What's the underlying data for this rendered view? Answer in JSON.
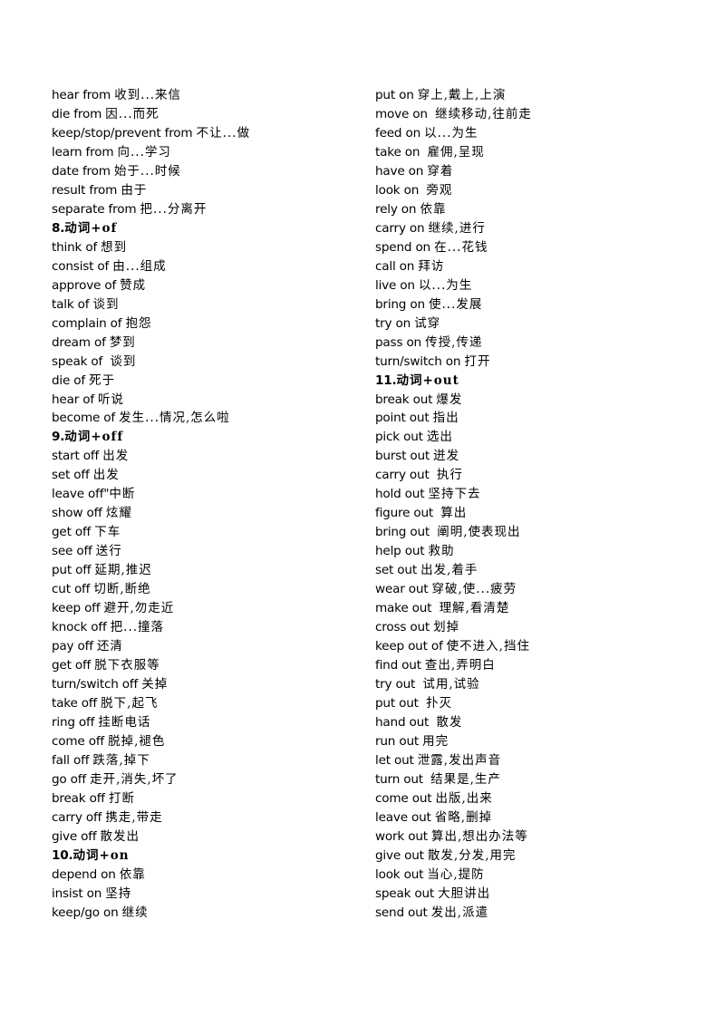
{
  "columns": [
    {
      "lines": [
        {
          "en": "hear from ",
          "zh": "收到...来信"
        },
        {
          "en": "die from ",
          "zh": "因...而死"
        },
        {
          "en": "keep/stop/prevent from ",
          "zh": "不让...做"
        },
        {
          "en": "learn from ",
          "zh": "向...学习"
        },
        {
          "en": "date from ",
          "zh": "始于...时候"
        },
        {
          "en": "result from ",
          "zh": "由于"
        },
        {
          "en": "separate from ",
          "zh": "把...分离开"
        },
        {
          "en": "8.",
          "zh": "动词+of",
          "header": true
        },
        {
          "en": "think of ",
          "zh": "想到"
        },
        {
          "en": "consist of ",
          "zh": "由...组成"
        },
        {
          "en": "approve of ",
          "zh": "赞成"
        },
        {
          "en": "talk of ",
          "zh": "谈到"
        },
        {
          "en": "complain of ",
          "zh": "抱怨"
        },
        {
          "en": "dream of ",
          "zh": "梦到"
        },
        {
          "en": "speak of  ",
          "zh": "谈到"
        },
        {
          "en": "die of ",
          "zh": "死于"
        },
        {
          "en": "hear of ",
          "zh": "听说"
        },
        {
          "en": "become of ",
          "zh": "发生...情况,怎么啦"
        },
        {
          "en": "9.",
          "zh": "动词+off",
          "header": true
        },
        {
          "en": "start off ",
          "zh": "出发"
        },
        {
          "en": "set off ",
          "zh": "出发"
        },
        {
          "en": "leave off\"",
          "zh": "中断"
        },
        {
          "en": "show off ",
          "zh": "炫耀"
        },
        {
          "en": "get off ",
          "zh": "下车"
        },
        {
          "en": "see off ",
          "zh": "送行"
        },
        {
          "en": "put off ",
          "zh": "延期,推迟"
        },
        {
          "en": "cut off ",
          "zh": "切断,断绝"
        },
        {
          "en": "keep off ",
          "zh": "避开,勿走近"
        },
        {
          "en": "knock off ",
          "zh": "把...撞落"
        },
        {
          "en": "pay off ",
          "zh": "还清"
        },
        {
          "en": "get off ",
          "zh": "脱下衣服等"
        },
        {
          "en": "turn/switch off ",
          "zh": "关掉"
        },
        {
          "en": "take off ",
          "zh": "脱下,起飞"
        },
        {
          "en": "ring off ",
          "zh": "挂断电话"
        },
        {
          "en": "come off ",
          "zh": "脱掉,褪色"
        },
        {
          "en": "fall off ",
          "zh": "跌落,掉下"
        },
        {
          "en": "go off ",
          "zh": "走开,消失,坏了"
        },
        {
          "en": "break off ",
          "zh": "打断"
        },
        {
          "en": "carry off ",
          "zh": "携走,带走"
        },
        {
          "en": "give off ",
          "zh": "散发出"
        },
        {
          "en": "10.",
          "zh": "动词+on",
          "header": true
        },
        {
          "en": "depend on ",
          "zh": "依靠"
        },
        {
          "en": "insist on ",
          "zh": "坚持"
        },
        {
          "en": "keep/go on ",
          "zh": "继续"
        }
      ]
    },
    {
      "lines": [
        {
          "en": "put on ",
          "zh": "穿上,戴上,上演"
        },
        {
          "en": "move on  ",
          "zh": "继续移动,往前走"
        },
        {
          "en": "feed on ",
          "zh": "以...为生"
        },
        {
          "en": "take on  ",
          "zh": "雇佣,呈现"
        },
        {
          "en": "have on ",
          "zh": "穿着"
        },
        {
          "en": "look on  ",
          "zh": "旁观"
        },
        {
          "en": "rely on ",
          "zh": "依靠"
        },
        {
          "en": "carry on ",
          "zh": "继续,进行"
        },
        {
          "en": "spend on ",
          "zh": "在...花钱"
        },
        {
          "en": "call on ",
          "zh": "拜访"
        },
        {
          "en": "live on ",
          "zh": "以...为生"
        },
        {
          "en": "bring on ",
          "zh": "使...发展"
        },
        {
          "en": "try on ",
          "zh": "试穿"
        },
        {
          "en": "pass on ",
          "zh": "传授,传递"
        },
        {
          "en": "turn/switch on ",
          "zh": "打开"
        },
        {
          "en": "11.",
          "zh": "动词+out",
          "header": true
        },
        {
          "en": "break out ",
          "zh": "爆发"
        },
        {
          "en": "point out ",
          "zh": "指出"
        },
        {
          "en": "pick out ",
          "zh": "选出"
        },
        {
          "en": "burst out ",
          "zh": "迸发"
        },
        {
          "en": "carry out  ",
          "zh": "执行"
        },
        {
          "en": "hold out ",
          "zh": "坚持下去"
        },
        {
          "en": "figure out  ",
          "zh": "算出"
        },
        {
          "en": "bring out  ",
          "zh": "阐明,使表现出"
        },
        {
          "en": "help out ",
          "zh": "救助"
        },
        {
          "en": "set out ",
          "zh": "出发,着手"
        },
        {
          "en": "wear out ",
          "zh": "穿破,使...疲劳"
        },
        {
          "en": "make out  ",
          "zh": "理解,看清楚"
        },
        {
          "en": "cross out ",
          "zh": "划掉"
        },
        {
          "en": "keep out of ",
          "zh": "使不进入,挡住"
        },
        {
          "en": "find out ",
          "zh": "查出,弄明白"
        },
        {
          "en": "try out  ",
          "zh": "试用,试验"
        },
        {
          "en": "put out  ",
          "zh": "扑灭"
        },
        {
          "en": "hand out  ",
          "zh": "散发"
        },
        {
          "en": "run out ",
          "zh": "用完"
        },
        {
          "en": "let out ",
          "zh": "泄露,发出声音"
        },
        {
          "en": "turn out  ",
          "zh": "结果是,生产"
        },
        {
          "en": "come out ",
          "zh": "出版,出来"
        },
        {
          "en": "leave out ",
          "zh": "省略,删掉"
        },
        {
          "en": "work out ",
          "zh": "算出,想出办法等"
        },
        {
          "en": "give out ",
          "zh": "散发,分发,用完"
        },
        {
          "en": "look out ",
          "zh": "当心,提防"
        },
        {
          "en": "speak out ",
          "zh": "大胆讲出"
        },
        {
          "en": "send out ",
          "zh": "发出,派遣"
        }
      ]
    }
  ]
}
